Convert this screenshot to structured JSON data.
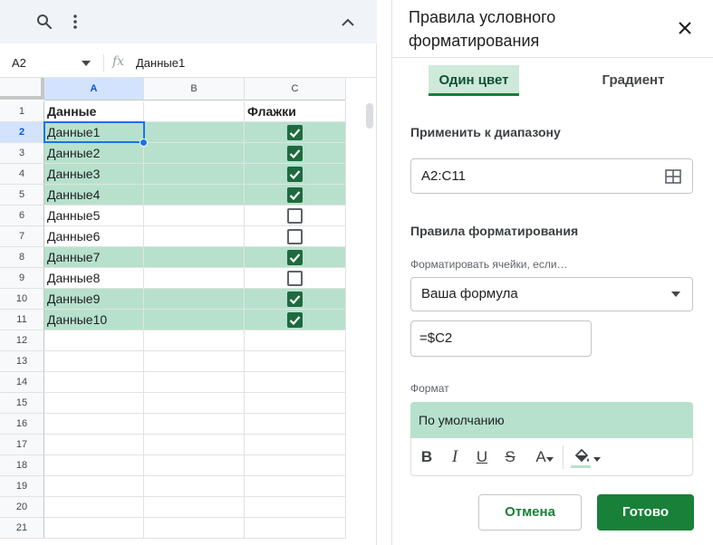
{
  "toolbar": {
    "search_icon": "search-icon",
    "menu_icon": "more-vert-icon",
    "collapse_icon": "chevron-up-icon"
  },
  "formula_bar": {
    "cell_ref": "A2",
    "fx_symbol": "fx",
    "value": "Данные1"
  },
  "sheet": {
    "columns": [
      "A",
      "B",
      "C"
    ],
    "rows": [
      "1",
      "2",
      "3",
      "4",
      "5",
      "6",
      "7",
      "8",
      "9",
      "10",
      "11",
      "12",
      "13",
      "14",
      "15",
      "16",
      "17",
      "18",
      "19",
      "20",
      "21"
    ],
    "header_row": {
      "a": "Данные",
      "c": "Флажки"
    },
    "data": [
      {
        "a": "Данные1",
        "checked": true
      },
      {
        "a": "Данные2",
        "checked": true
      },
      {
        "a": "Данные3",
        "checked": true
      },
      {
        "a": "Данные4",
        "checked": true
      },
      {
        "a": "Данные5",
        "checked": false
      },
      {
        "a": "Данные6",
        "checked": false
      },
      {
        "a": "Данные7",
        "checked": true
      },
      {
        "a": "Данные8",
        "checked": false
      },
      {
        "a": "Данные9",
        "checked": true
      },
      {
        "a": "Данные10",
        "checked": true
      }
    ],
    "highlight_color": "#b7e1cd",
    "checkbox_color": "#1e6a3f"
  },
  "panel": {
    "title": "Правила условного форматирования",
    "tabs": {
      "single": "Один цвет",
      "gradient": "Градиент"
    },
    "apply_range_label": "Применить к диапазону",
    "range_value": "A2:C11",
    "rules_label": "Правила форматирования",
    "condition_label": "Форматировать ячейки, если…",
    "condition_value": "Ваша формула",
    "formula_value": "=$C2",
    "format_label": "Формат",
    "format_preview": "По умолчанию",
    "format_tools": {
      "bold": "B",
      "italic": "I",
      "underline": "U",
      "strike": "S",
      "text_color": "A"
    },
    "cancel_label": "Отмена",
    "done_label": "Готово",
    "accent_color": "#188038"
  }
}
